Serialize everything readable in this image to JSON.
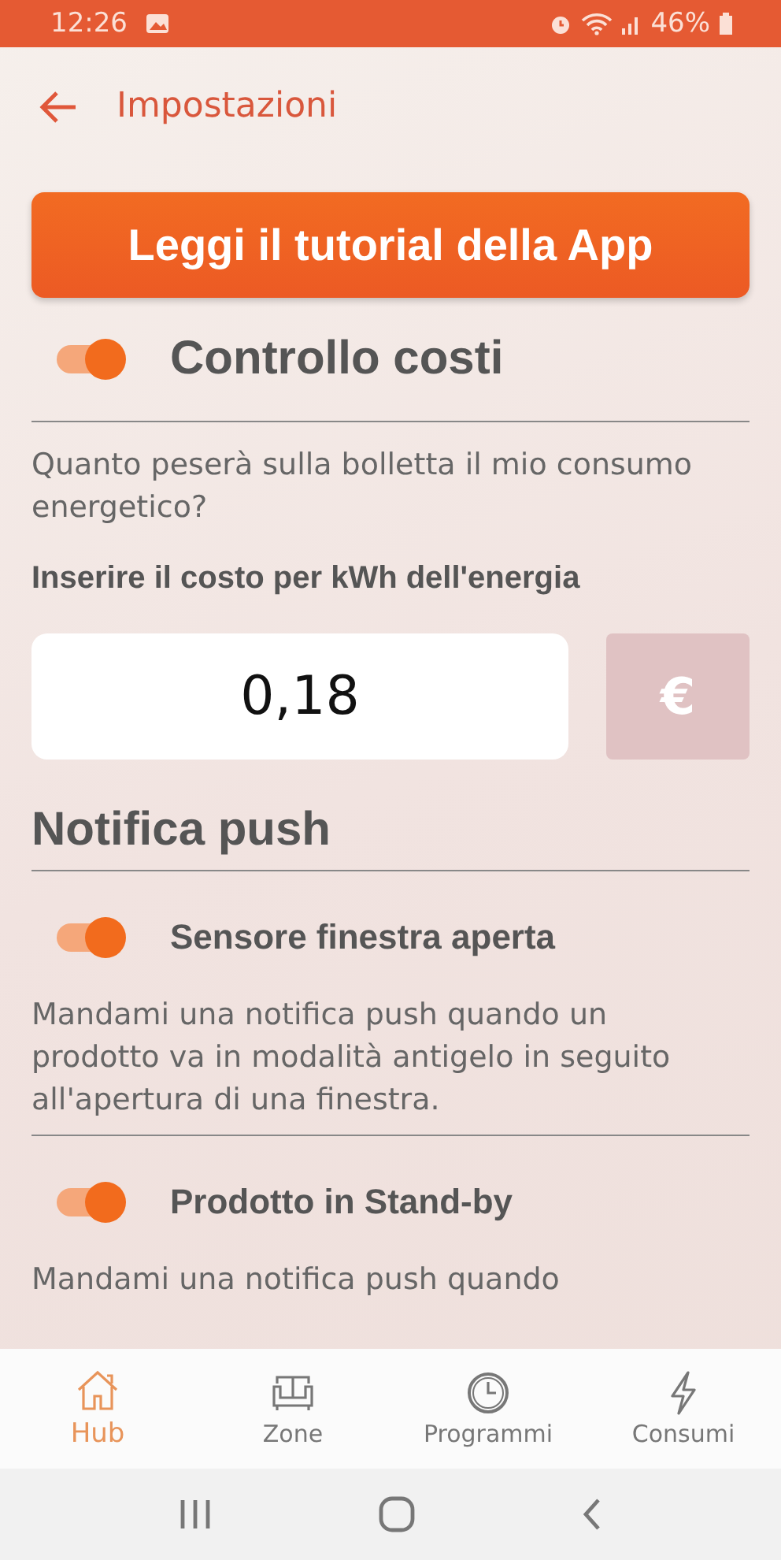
{
  "status_bar": {
    "time": "12:26",
    "battery": "46%"
  },
  "header": {
    "title": "Impostazioni"
  },
  "tutorial_button": {
    "label": "Leggi il tutorial della App"
  },
  "sections": [
    {
      "kind": "toggle",
      "title": "Controllo costi",
      "on": true,
      "description": "Quanto peserà sulla bolletta il mio consumo energetico?",
      "cost_label": "Inserire il costo per kWh dell'energia",
      "cost_value": "0,18",
      "currency": "€"
    },
    {
      "kind": "heading",
      "title": "Notifica push"
    },
    {
      "kind": "option",
      "title": "Sensore finestra aperta",
      "on": true,
      "description": "Mandami una notifica push quando un prodotto va in modalità antigelo in seguito all'apertura di una finestra."
    },
    {
      "kind": "option",
      "title": "Prodotto in Stand-by",
      "on": true,
      "description": "Mandami una notifica push quando"
    }
  ],
  "tab_bar": [
    {
      "label": "Hub",
      "selected": true
    },
    {
      "label": "Zone",
      "selected": false
    },
    {
      "label": "Programmi",
      "selected": false
    },
    {
      "label": "Consumi",
      "selected": false
    }
  ]
}
